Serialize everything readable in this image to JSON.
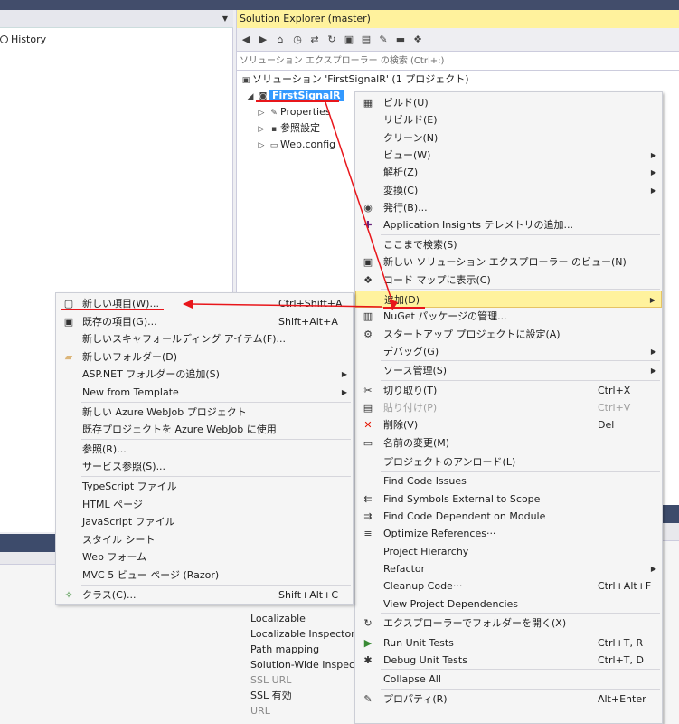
{
  "left_pane": {
    "history_label": "History"
  },
  "solution_explorer": {
    "title": "Solution Explorer (master)",
    "search_placeholder": "ソリューション エクスプローラー の検索 (Ctrl+:)",
    "tree": [
      {
        "label": "ソリューション 'FirstSignalR' (1 プロジェクト)",
        "icon": "solution-icon"
      },
      {
        "label": "FirstSignalR",
        "icon": "web-project-icon",
        "selected": true
      },
      {
        "label": "Properties",
        "icon": "wrench-icon"
      },
      {
        "label": "参照設定",
        "icon": "references-icon"
      },
      {
        "label": "Web.config",
        "icon": "config-file-icon"
      }
    ]
  },
  "properties": {
    "rows": [
      {
        "label": "Localizable",
        "dim": false
      },
      {
        "label": "Localizable Inspector",
        "dim": false
      },
      {
        "label": "Path mapping",
        "dim": false
      },
      {
        "label": "Solution-Wide Inspect",
        "dim": false
      },
      {
        "label": "SSL URL",
        "dim": true
      },
      {
        "label": "SSL 有効",
        "dim": false
      },
      {
        "label": "URL",
        "dim": true
      }
    ]
  },
  "context_menu": {
    "items": [
      {
        "label": "ビルド(U)",
        "icon": "build-icon"
      },
      {
        "label": "リビルド(E)"
      },
      {
        "label": "クリーン(N)"
      },
      {
        "label": "ビュー(W)",
        "submenu": true
      },
      {
        "label": "解析(Z)",
        "submenu": true
      },
      {
        "label": "変換(C)",
        "submenu": true
      },
      {
        "label": "発行(B)...",
        "icon": "publish-icon"
      },
      {
        "label": "Application Insights テレメトリの追加...",
        "icon": "insights-icon"
      },
      {
        "label": "ここまで検索(S)",
        "sep_before": true
      },
      {
        "label": "新しい ソリューション エクスプローラー のビュー(N)",
        "icon": "new-view-icon"
      },
      {
        "label": "コード マップに表示(C)",
        "icon": "code-map-icon"
      },
      {
        "label": "追加(D)",
        "submenu": true,
        "highlight": true,
        "sep_before": true
      },
      {
        "label": "NuGet パッケージの管理...",
        "icon": "nuget-icon"
      },
      {
        "label": "スタートアップ プロジェクトに設定(A)",
        "icon": "gear-icon"
      },
      {
        "label": "デバッグ(G)",
        "submenu": true
      },
      {
        "label": "ソース管理(S)",
        "submenu": true,
        "sep_before": true
      },
      {
        "label": "切り取り(T)",
        "shortcut": "Ctrl+X",
        "icon": "scissors-icon",
        "sep_before": true
      },
      {
        "label": "貼り付け(P)",
        "shortcut": "Ctrl+V",
        "icon": "paste-icon",
        "disabled": true
      },
      {
        "label": "削除(V)",
        "shortcut": "Del",
        "icon": "delete-icon"
      },
      {
        "label": "名前の変更(M)",
        "icon": "rename-icon"
      },
      {
        "label": "プロジェクトのアンロード(L)",
        "sep_before": true
      },
      {
        "label": "Find Code Issues",
        "sep_before": true
      },
      {
        "label": "Find Symbols External to Scope",
        "icon": "find-external-icon"
      },
      {
        "label": "Find Code Dependent on Module",
        "icon": "find-dependent-icon"
      },
      {
        "label": "Optimize References···",
        "icon": "optimize-icon"
      },
      {
        "label": "Project Hierarchy"
      },
      {
        "label": "Refactor",
        "submenu": true
      },
      {
        "label": "Cleanup Code···",
        "shortcut": "Ctrl+Alt+F"
      },
      {
        "label": "View Project Dependencies"
      },
      {
        "label": "エクスプローラーでフォルダーを開く(X)",
        "icon": "open-folder-icon",
        "sep_before": true
      },
      {
        "label": "Run Unit Tests",
        "shortcut": "Ctrl+T, R",
        "icon": "run-tests-icon",
        "sep_before": true
      },
      {
        "label": "Debug Unit Tests",
        "shortcut": "Ctrl+T, D",
        "icon": "debug-tests-icon"
      },
      {
        "label": "Collapse All",
        "sep_before": true
      },
      {
        "label": "プロパティ(R)",
        "shortcut": "Alt+Enter",
        "icon": "wrench-icon",
        "sep_before": true
      }
    ]
  },
  "add_submenu": {
    "items": [
      {
        "label": "新しい項目(W)...",
        "shortcut": "Ctrl+Shift+A",
        "icon": "new-item-icon"
      },
      {
        "label": "既存の項目(G)...",
        "shortcut": "Shift+Alt+A",
        "icon": "existing-item-icon"
      },
      {
        "label": "新しいスキャフォールディング アイテム(F)..."
      },
      {
        "label": "新しいフォルダー(D)",
        "icon": "new-folder-icon"
      },
      {
        "label": "ASP.NET フォルダーの追加(S)",
        "submenu": true
      },
      {
        "label": "New from Template",
        "submenu": true
      },
      {
        "label": "新しい Azure WebJob プロジェクト",
        "sep_before": true
      },
      {
        "label": "既存プロジェクトを Azure WebJob に使用"
      },
      {
        "label": "参照(R)...",
        "sep_before": true
      },
      {
        "label": "サービス参照(S)..."
      },
      {
        "label": "TypeScript ファイル",
        "sep_before": true
      },
      {
        "label": "HTML ページ"
      },
      {
        "label": "JavaScript ファイル"
      },
      {
        "label": "スタイル シート"
      },
      {
        "label": "Web フォーム"
      },
      {
        "label": "MVC 5 ビュー ページ (Razor)"
      },
      {
        "label": "クラス(C)...",
        "shortcut": "Shift+Alt+C",
        "icon": "class-icon",
        "sep_before": true
      }
    ]
  },
  "colors": {
    "highlight": "#fff29d",
    "selection": "#3399ff",
    "annotation": "#e8161b"
  }
}
